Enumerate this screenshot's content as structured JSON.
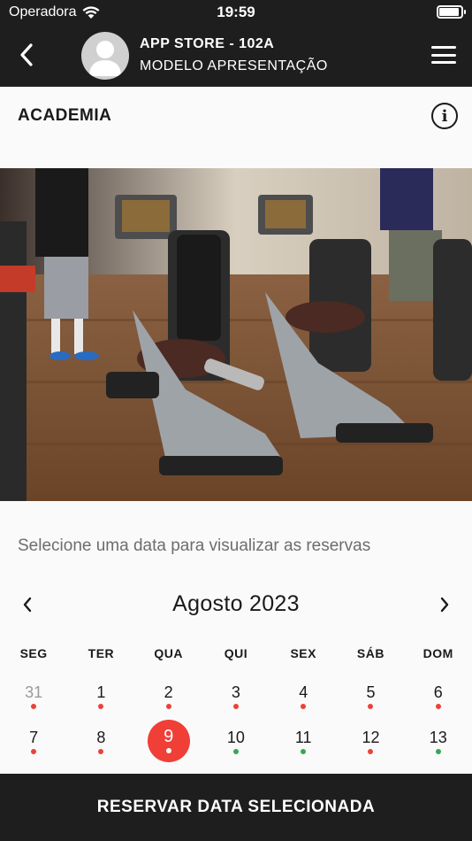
{
  "status_bar": {
    "carrier": "Operadora",
    "time": "19:59"
  },
  "header": {
    "title": "APP STORE - 102A",
    "subtitle": "MODELO APRESENTAÇÃO",
    "back_icon": "chevron-left-icon",
    "menu_icon": "hamburger-menu-icon"
  },
  "section": {
    "title": "ACADEMIA",
    "info_icon": "info-icon"
  },
  "hint": "Selecione uma data para visualizar as reservas",
  "calendar": {
    "month": "Agosto 2023",
    "weekdays": [
      "SEG",
      "TER",
      "QUA",
      "QUI",
      "SEX",
      "SÁB",
      "DOM"
    ],
    "days": [
      {
        "n": "31",
        "dot": "red",
        "muted": true
      },
      {
        "n": "1",
        "dot": "red"
      },
      {
        "n": "2",
        "dot": "red"
      },
      {
        "n": "3",
        "dot": "red"
      },
      {
        "n": "4",
        "dot": "red"
      },
      {
        "n": "5",
        "dot": "red"
      },
      {
        "n": "6",
        "dot": "red"
      },
      {
        "n": "7",
        "dot": "red"
      },
      {
        "n": "8",
        "dot": "red"
      },
      {
        "n": "9",
        "dot": "white",
        "selected": true
      },
      {
        "n": "10",
        "dot": "green"
      },
      {
        "n": "11",
        "dot": "green"
      },
      {
        "n": "12",
        "dot": "red"
      },
      {
        "n": "13",
        "dot": "green"
      }
    ],
    "colors": {
      "selected": "#ef3f37",
      "unavailable_dot": "#e8433a",
      "available_dot": "#34a853"
    }
  },
  "footer": {
    "button_label": "RESERVAR DATA SELECIONADA"
  }
}
